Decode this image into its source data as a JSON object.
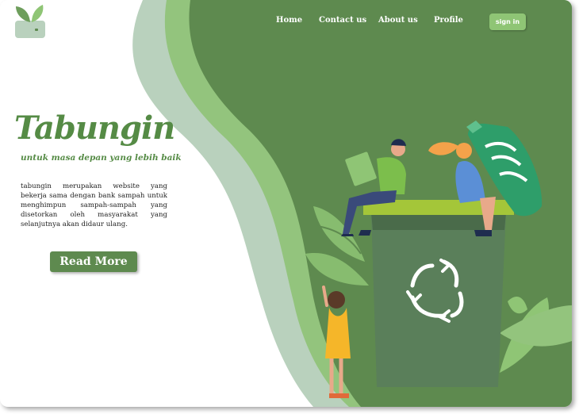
{
  "nav": {
    "home": "Home",
    "contact": "Contact us",
    "about": "About us",
    "profile": "Profile",
    "signin": "sign in"
  },
  "hero": {
    "title": "Tabungin",
    "subtitle": "untuk masa depan yang lebih baik",
    "description": "tabungin merupakan website yang bekerja sama dengan bank sampah untuk menghimpun sampah-sampah yang disetorkan oleh masyarakat yang selanjutnya akan didaur ulang.",
    "read_more": "Read More"
  },
  "colors": {
    "primary_green": "#5e8a4f",
    "light_green": "#8fc575",
    "pale_green": "#b9d1bd",
    "bin_green": "#5a7f5a"
  },
  "icons": [
    "logo-leaf-wallet-icon",
    "recycle-icon",
    "plastic-bottle-icon",
    "book-icon"
  ]
}
